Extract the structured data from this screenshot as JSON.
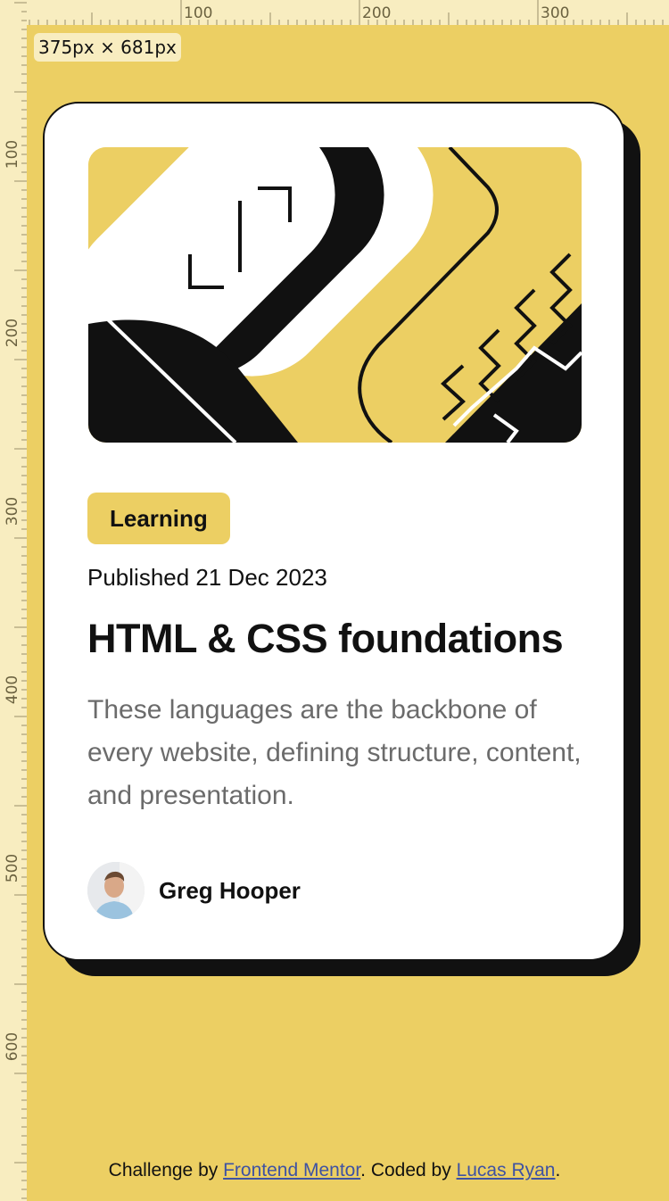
{
  "overlay": {
    "size_label": "375px × 681px",
    "ruler_top": [
      "100",
      "200",
      "300"
    ],
    "ruler_left": [
      "100",
      "200",
      "300",
      "400",
      "500",
      "600"
    ]
  },
  "card": {
    "tag": "Learning",
    "published": "Published 21 Dec 2023",
    "title": "HTML & CSS foundations",
    "description": "These languages are the backbone of every website, defining structure, content, and presentation.",
    "author": "Greg Hooper"
  },
  "footer": {
    "prefix": "Challenge by ",
    "link1": "Frontend Mentor",
    "middle": ". Coded by ",
    "link2": "Lucas Ryan",
    "suffix": "."
  },
  "colors": {
    "background": "#eccf63",
    "card": "#ffffff",
    "ink": "#111111",
    "muted": "#6b6b6b",
    "link": "#3e52a3"
  },
  "icons": {
    "hero": "abstract-illustration",
    "avatar": "author-avatar"
  }
}
